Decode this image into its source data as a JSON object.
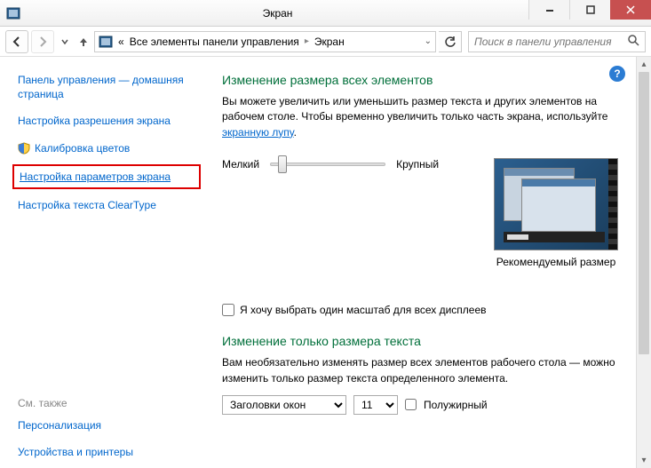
{
  "window": {
    "title": "Экран"
  },
  "nav": {
    "breadcrumb_root": "«",
    "breadcrumb1": "Все элементы панели управления",
    "breadcrumb2": "Экран",
    "search_placeholder": "Поиск в панели управления"
  },
  "sidebar": {
    "home": "Панель управления — домашняя страница",
    "resolution": "Настройка разрешения экрана",
    "calibration": "Калибровка цветов",
    "params": "Настройка параметров экрана",
    "cleartype": "Настройка текста ClearType",
    "see_also": "См. также",
    "personalization": "Персонализация",
    "devices": "Устройства и принтеры"
  },
  "content": {
    "h1": "Изменение размера всех элементов",
    "p1a": "Вы можете увеличить или уменьшить размер текста и других элементов на рабочем столе. Чтобы временно увеличить только часть экрана, используйте ",
    "p1_link": "экранную лупу",
    "slider_small": "Мелкий",
    "slider_large": "Крупный",
    "recommended": "Рекомендуемый размер",
    "chk_label": "Я хочу выбрать один масштаб для всех дисплеев",
    "h2": "Изменение только размера текста",
    "p2": "Вам необязательно изменять размер всех элементов рабочего стола — можно изменить только размер текста определенного элемента.",
    "select_element": "Заголовки окон",
    "select_size": "11",
    "bold": "Полужирный"
  }
}
